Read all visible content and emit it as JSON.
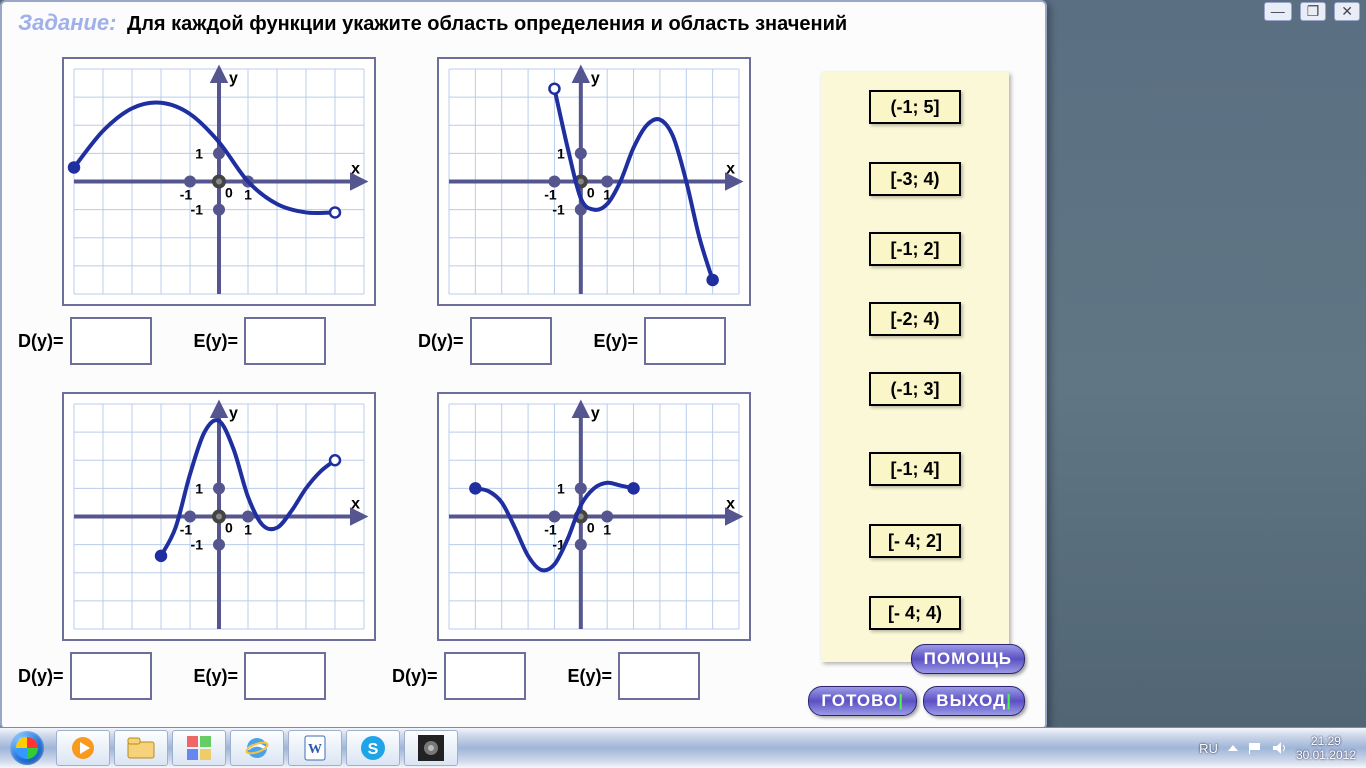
{
  "task": {
    "label": "Задание:",
    "text": "Для каждой функции укажите область определения и область значений"
  },
  "axis": {
    "x": "x",
    "y": "y",
    "neg1": "-1",
    "pos1": "1",
    "zero": "0"
  },
  "labels": {
    "domain": "D(y)=",
    "range": "E(y)="
  },
  "tiles": [
    "(-1; 5]",
    "[-3; 4)",
    "[-1; 2]",
    "[-2; 4)",
    "(-1; 3]",
    "[-1; 4]",
    "[- 4; 2]",
    "[- 4; 4)"
  ],
  "buttons": {
    "help": "ПОМОЩЬ",
    "done": "ГОТОВО",
    "exit": "ВЫХОД"
  },
  "winctrl": {
    "min": "—",
    "max": "❐",
    "close": "✕"
  },
  "taskbar": {
    "lang": "RU",
    "time": "21:29",
    "date": "30.01.2012"
  },
  "chart_data": [
    {
      "type": "line",
      "xlabel": "x",
      "ylabel": "y",
      "grid": true,
      "xlim": [
        -5,
        5
      ],
      "ylim": [
        -4,
        4
      ],
      "series": [
        {
          "name": "f1",
          "x": [
            -5,
            -4,
            -3,
            -2,
            -1,
            0,
            1,
            2,
            3,
            4
          ],
          "y": [
            0.5,
            1.8,
            2.6,
            2.8,
            2.4,
            1.4,
            0,
            -0.8,
            -1.1,
            -1.1
          ],
          "endpoints": {
            "left": "closed",
            "right": "open"
          }
        }
      ]
    },
    {
      "type": "line",
      "xlabel": "x",
      "ylabel": "y",
      "grid": true,
      "xlim": [
        -5,
        6
      ],
      "ylim": [
        -4,
        4
      ],
      "series": [
        {
          "name": "f2",
          "x": [
            -1,
            -0.5,
            0,
            0.5,
            1,
            1.5,
            2,
            2.5,
            3,
            3.5,
            4,
            4.5,
            5
          ],
          "y": [
            3.3,
            1.2,
            -0.6,
            -1.0,
            -0.8,
            0.0,
            1.2,
            2.0,
            2.2,
            1.6,
            0.0,
            -2.0,
            -3.5
          ],
          "endpoints": {
            "left": "open",
            "right": "closed"
          }
        }
      ]
    },
    {
      "type": "line",
      "xlabel": "x",
      "ylabel": "y",
      "grid": true,
      "xlim": [
        -5,
        5
      ],
      "ylim": [
        -4,
        4
      ],
      "series": [
        {
          "name": "f3",
          "x": [
            -2,
            -1.5,
            -1,
            -0.5,
            0,
            0.5,
            1,
            1.5,
            2,
            2.5,
            3,
            3.5,
            4
          ],
          "y": [
            -1.4,
            -0.4,
            1.5,
            3.0,
            3.4,
            2.4,
            0.7,
            -0.3,
            -0.4,
            0.2,
            1.0,
            1.6,
            2.0
          ],
          "endpoints": {
            "left": "closed",
            "right": "open"
          }
        }
      ]
    },
    {
      "type": "line",
      "xlabel": "x",
      "ylabel": "y",
      "grid": true,
      "xlim": [
        -5,
        6
      ],
      "ylim": [
        -4,
        4
      ],
      "series": [
        {
          "name": "f4",
          "x": [
            -4,
            -3.5,
            -3,
            -2.5,
            -2,
            -1.5,
            -1,
            -0.5,
            0,
            0.5,
            1,
            1.5,
            2
          ],
          "y": [
            1.0,
            0.9,
            0.5,
            -0.4,
            -1.4,
            -1.9,
            -1.7,
            -0.8,
            0.4,
            1.0,
            1.2,
            1.1,
            1.0
          ],
          "endpoints": {
            "left": "closed",
            "right": "closed"
          }
        }
      ]
    }
  ]
}
